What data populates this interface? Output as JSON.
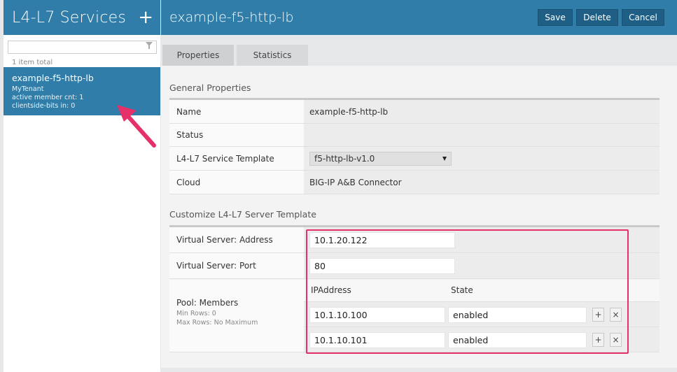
{
  "sidebar": {
    "title": "L4-L7 Services",
    "add_label": "+",
    "filter_placeholder": "",
    "count": "1 item total",
    "items": [
      {
        "name": "example-f5-http-lb",
        "tenant": "MyTenant",
        "active_members": "active member cnt: 1",
        "clientside_bits": "clientside-bits in: 0"
      }
    ]
  },
  "header": {
    "title": "example-f5-http-lb",
    "save_label": "Save",
    "delete_label": "Delete",
    "cancel_label": "Cancel"
  },
  "tabs": [
    {
      "label": "Properties",
      "active": true
    },
    {
      "label": "Statistics",
      "active": false
    }
  ],
  "general": {
    "section_title": "General Properties",
    "name_label": "Name",
    "name_value": "example-f5-http-lb",
    "status_label": "Status",
    "status_value": "",
    "template_label": "L4-L7 Service Template",
    "template_value": "f5-http-lb-v1.0",
    "cloud_label": "Cloud",
    "cloud_value": "BIG-IP A&B Connector"
  },
  "customize": {
    "section_title": "Customize L4-L7 Server Template",
    "vs_address_label": "Virtual Server: Address",
    "vs_address_value": "10.1.20.122",
    "vs_port_label": "Virtual Server: Port",
    "vs_port_value": "80",
    "pool_label": "Pool: Members",
    "pool_min_rows": "Min Rows: 0",
    "pool_max_rows": "Max Rows: No Maximum",
    "col_ip": "IPAddress",
    "col_state": "State",
    "members": [
      {
        "ip": "10.1.10.100",
        "state": "enabled"
      },
      {
        "ip": "10.1.10.101",
        "state": "enabled"
      }
    ],
    "add_row_symbol": "+",
    "remove_row_symbol": "×"
  },
  "colors": {
    "accent": "#2f7da8",
    "button": "#1f5f85",
    "highlight": "#e6306a"
  }
}
